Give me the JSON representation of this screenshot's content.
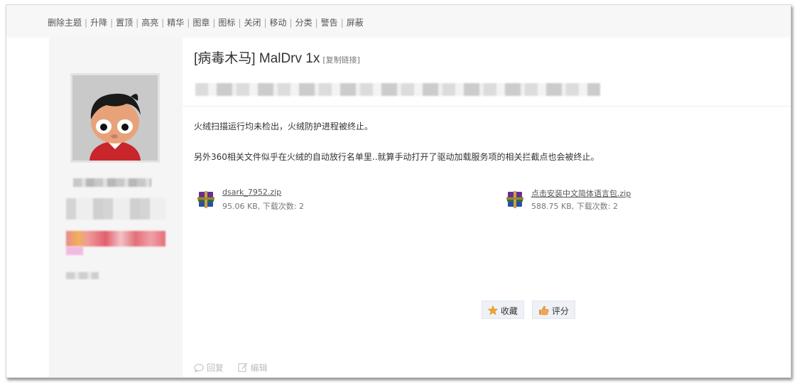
{
  "mod_actions": [
    "删除主题",
    "升降",
    "置顶",
    "高亮",
    "精华",
    "图章",
    "图标",
    "关闭",
    "移动",
    "分类",
    "警告",
    "屏蔽"
  ],
  "post": {
    "title": "[病毒木马] MalDrv 1x",
    "copy_link": "[复制链接]",
    "paragraph_1": "火绒扫描运行均未检出，火绒防护进程被终止。",
    "paragraph_2": "另外360相关文件似乎在火绒的自动放行名单里..就算手动打开了驱动加载服务项的相关拦截点也会被终止。"
  },
  "attachments": [
    {
      "name": "dsark_7952.zip",
      "info": "95.06 KB, 下载次数: 2",
      "icon": "winrar-archive-icon"
    },
    {
      "name": "点击安装中文简体语言包.zip",
      "info": "588.75 KB, 下载次数: 2",
      "icon": "winrar-archive-icon"
    }
  ],
  "actions": {
    "favorite": "收藏",
    "rate": "评分"
  },
  "footer": {
    "reply": "回复",
    "edit": "编辑"
  },
  "colors": {
    "background": "#ffffff",
    "sidebar": "#f5f5f5",
    "modbar": "#f7f7f7",
    "button_bg": "#eef1f5"
  }
}
